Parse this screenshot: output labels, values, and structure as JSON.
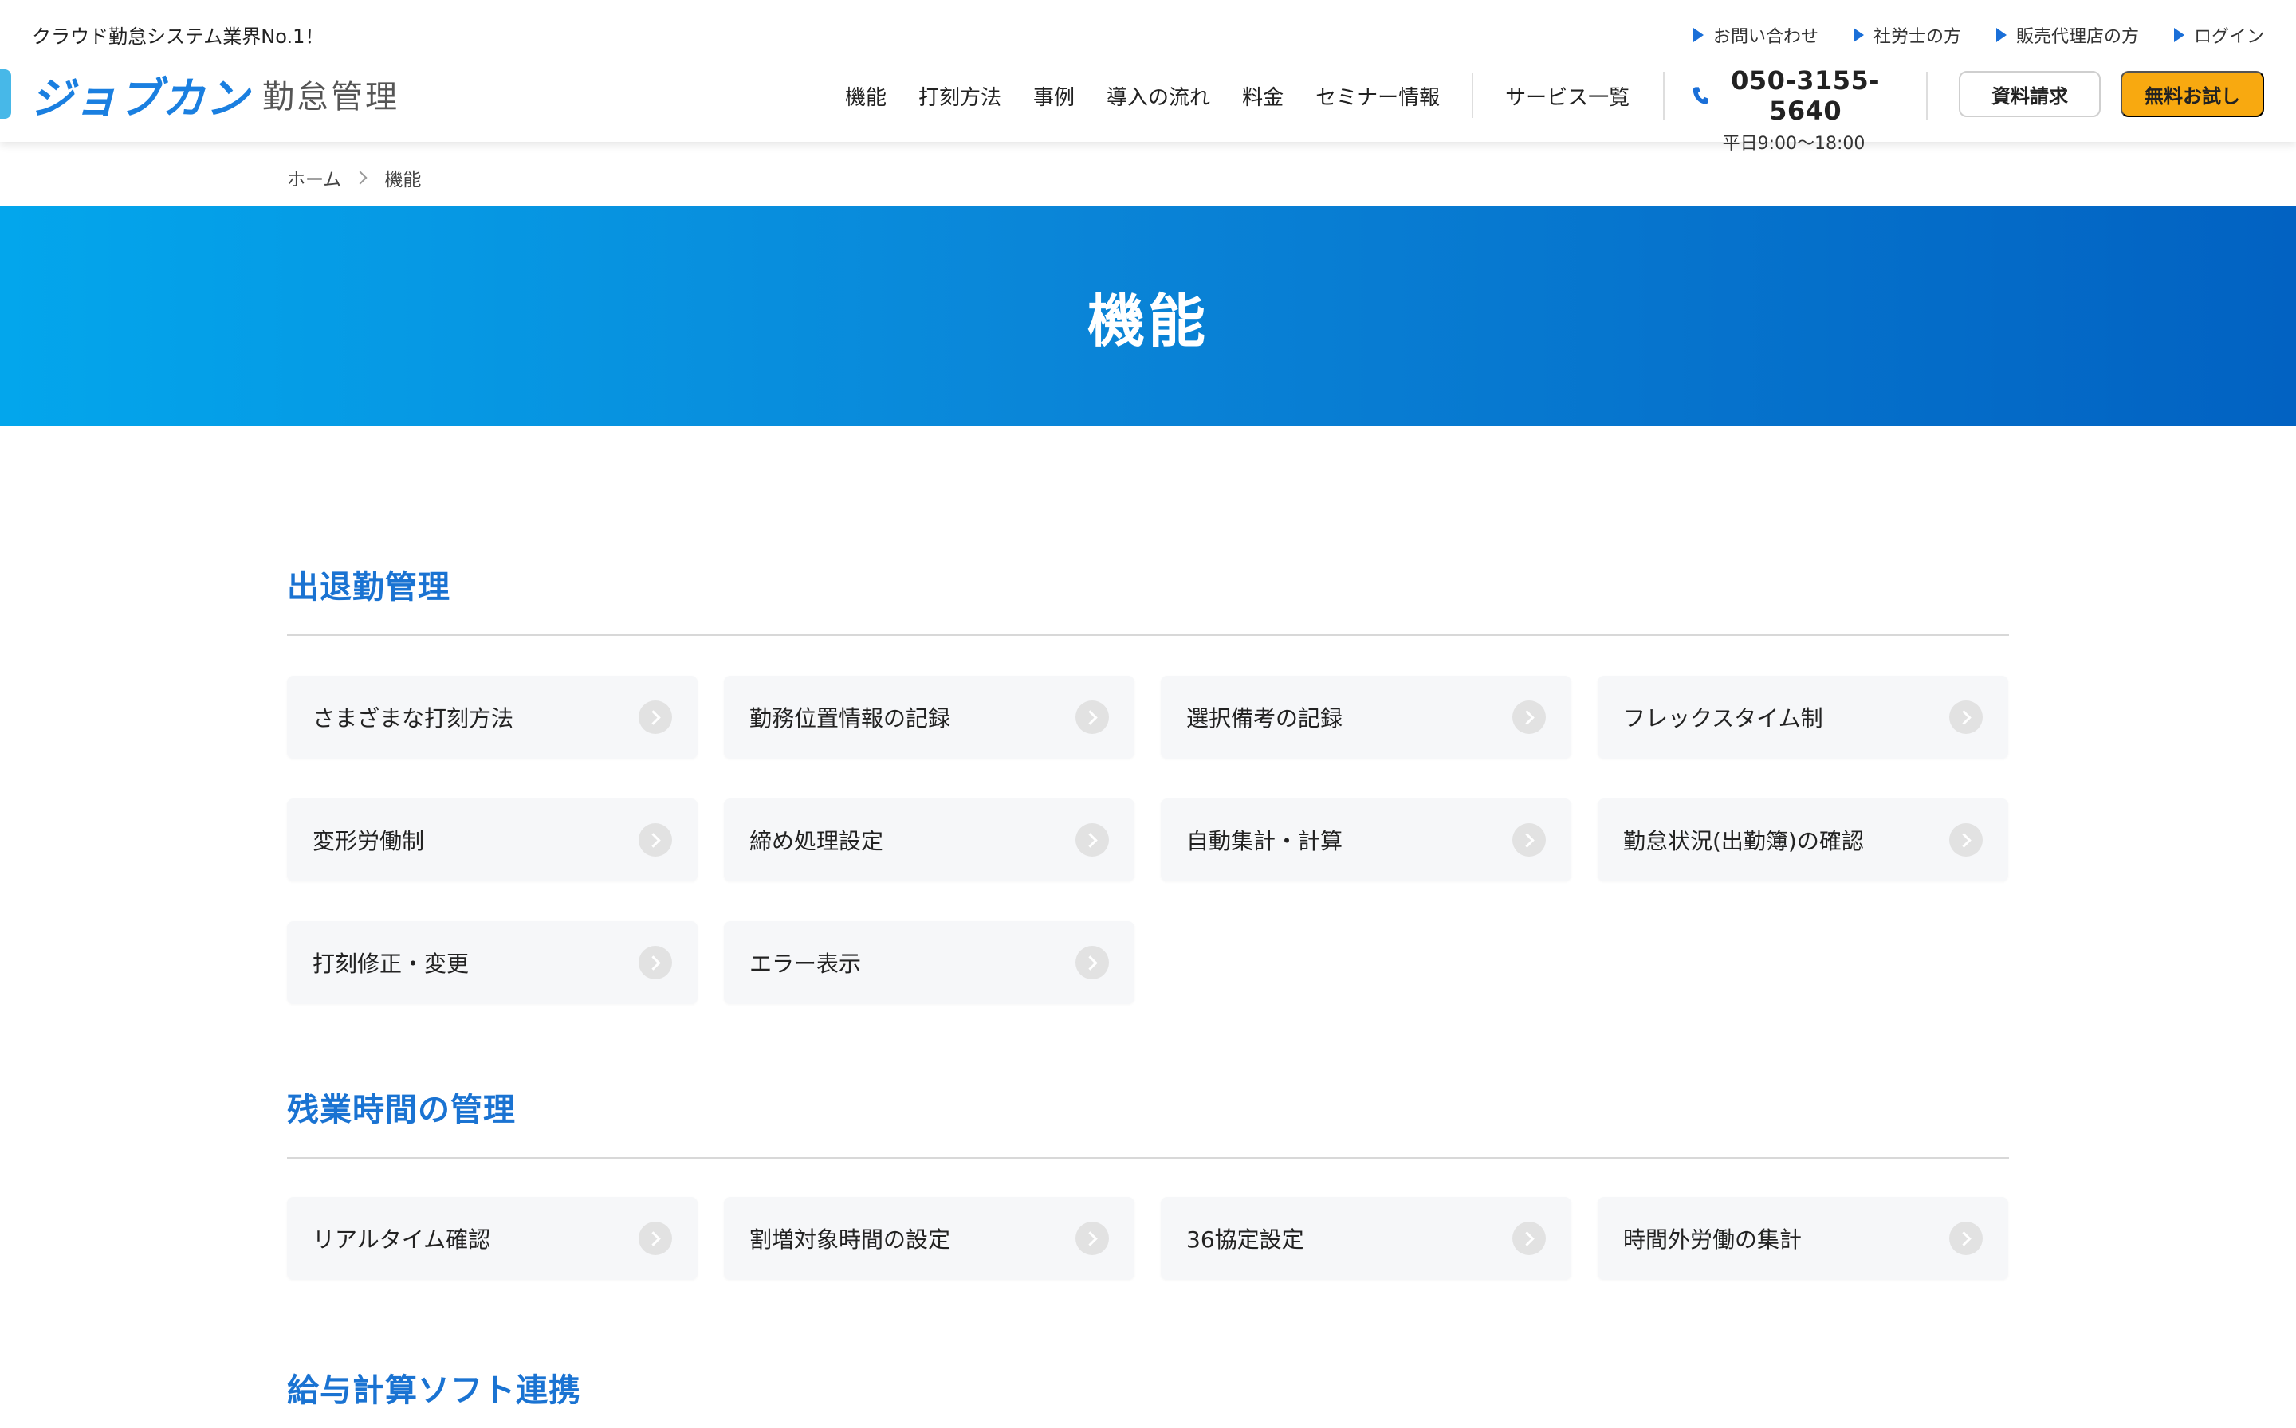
{
  "header": {
    "tagline": "クラウド勤怠システム業界No.1！",
    "util_links": [
      "お問い合わせ",
      "社労士の方",
      "販売代理店の方",
      "ログイン"
    ],
    "logo_main": "ジョブカン",
    "logo_sub": "勤怠管理",
    "nav": [
      "機能",
      "打刻方法",
      "事例",
      "導入の流れ",
      "料金",
      "セミナー情報"
    ],
    "services": "サービス一覧",
    "phone_number": "050-3155-5640",
    "phone_hours": "平日9:00〜18:00",
    "btn_doc": "資料請求",
    "btn_trial": "無料お試し"
  },
  "breadcrumb": {
    "home": "ホーム",
    "current": "機能"
  },
  "hero": {
    "title": "機能"
  },
  "sections": [
    {
      "title": "出退勤管理",
      "items": [
        "さまざまな打刻方法",
        "勤務位置情報の記録",
        "選択備考の記録",
        "フレックスタイム制",
        "変形労働制",
        "締め処理設定",
        "自動集計・計算",
        "勤怠状況(出勤簿)の確認",
        "打刻修正・変更",
        "エラー表示"
      ]
    },
    {
      "title": "残業時間の管理",
      "items": [
        "リアルタイム確認",
        "割増対象時間の設定",
        "36協定設定",
        "時間外労働の集計"
      ]
    },
    {
      "title": "給与計算ソフト連携",
      "items": []
    }
  ],
  "colors": {
    "accent": "#1a73d2",
    "trial_button": "#f8a910",
    "hero_start": "#03a6ec",
    "hero_end": "#0262c2"
  }
}
